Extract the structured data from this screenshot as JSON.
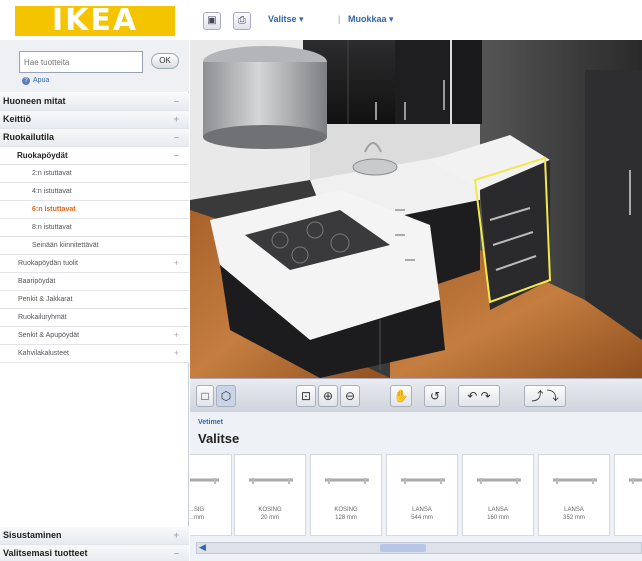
{
  "header": {
    "logo_text": "IKEA",
    "link_select": "Valitse ▾",
    "separator": "|",
    "link_edit": "Muokkaa ▾"
  },
  "sidebar": {
    "search_placeholder": "Hae tuotteita",
    "ok_label": "OK",
    "help_label": "Apua",
    "rows": [
      {
        "label": "Huoneen mitat",
        "kind": "cat",
        "exp": "–"
      },
      {
        "label": "Keittiö",
        "kind": "cat",
        "exp": "+"
      },
      {
        "label": "Ruokailutila",
        "kind": "cat",
        "exp": "–"
      },
      {
        "label": "Ruokapöydät",
        "kind": "subcat",
        "exp": "–"
      },
      {
        "label": "2:n istuttavat",
        "kind": "item",
        "exp": ""
      },
      {
        "label": "4:n istuttavat",
        "kind": "item",
        "exp": ""
      },
      {
        "label": "6:n istuttavat",
        "kind": "item-active",
        "exp": ""
      },
      {
        "label": "8:n istuttavat",
        "kind": "item",
        "exp": ""
      },
      {
        "label": "Seinään kiinnitettävät",
        "kind": "item",
        "exp": ""
      },
      {
        "label": "Ruokapöydän tuolit",
        "kind": "sub2",
        "exp": "+"
      },
      {
        "label": "Baaripöydät",
        "kind": "sub2",
        "exp": ""
      },
      {
        "label": "Penkit & Jakkarat",
        "kind": "sub2",
        "exp": ""
      },
      {
        "label": "Ruokailuryhmät",
        "kind": "sub2",
        "exp": ""
      },
      {
        "label": "Senkit & Apupöydät",
        "kind": "sub2",
        "exp": "+"
      },
      {
        "label": "Kahvilakalusteet",
        "kind": "sub2",
        "exp": "+"
      }
    ],
    "bottom": [
      {
        "label": "Sisustaminen",
        "exp": "+"
      },
      {
        "label": "Valitsemasi tuotteet",
        "exp": "–"
      }
    ]
  },
  "panel": {
    "category": "Vetimet",
    "title": "Valitse",
    "products": [
      {
        "name": "…SIG",
        "size": "…mm"
      },
      {
        "name": "KOSING",
        "size": "20 mm"
      },
      {
        "name": "KOSING",
        "size": "128 mm"
      },
      {
        "name": "LANSA",
        "size": "544 mm"
      },
      {
        "name": "LANSA",
        "size": "160 mm"
      },
      {
        "name": "LANSA",
        "size": "352 mm"
      },
      {
        "name": "L…",
        "size": "…"
      }
    ],
    "scroll_left": "◀"
  },
  "colors": {
    "logo_yellow": "#f5c400",
    "link_blue": "#3366b0",
    "active_orange": "#e0651c",
    "highlight_yellow": "#f2e84a"
  }
}
